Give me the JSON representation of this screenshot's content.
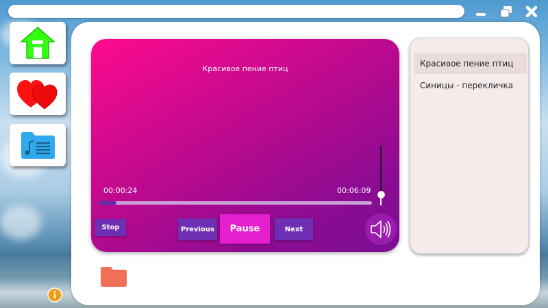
{
  "window": {
    "title": "",
    "minimize_icon": "minimize-icon",
    "restore_icon": "restore-icon",
    "close_icon": "close-icon"
  },
  "nav": {
    "items": [
      {
        "name": "home",
        "icon": "home-icon",
        "color": "#33ff12"
      },
      {
        "name": "favorites",
        "icon": "hearts-icon",
        "color": "#ff1010"
      },
      {
        "name": "playlists",
        "icon": "music-folder-icon",
        "color": "#2fa9ec"
      }
    ]
  },
  "player": {
    "track_title": "Красивое пение птиц",
    "current_time": "00:00:24",
    "total_time": "00:06:09",
    "progress": 0.065,
    "volume": 0.15,
    "buttons": {
      "stop": "Stop",
      "previous": "Previous",
      "pause": "Pause",
      "next": "Next"
    }
  },
  "playlist": {
    "items": [
      {
        "title": "Красивое пение птиц",
        "selected": true
      },
      {
        "title": "Синицы - перекличка",
        "selected": false
      }
    ]
  },
  "colors": {
    "player_gradient_start": "#ff0a8e",
    "player_gradient_end": "#7a0d94",
    "button": "#6e2fb4",
    "pause_button": "#e51ed0",
    "folder": "#f07057",
    "info": "#f59b10"
  }
}
